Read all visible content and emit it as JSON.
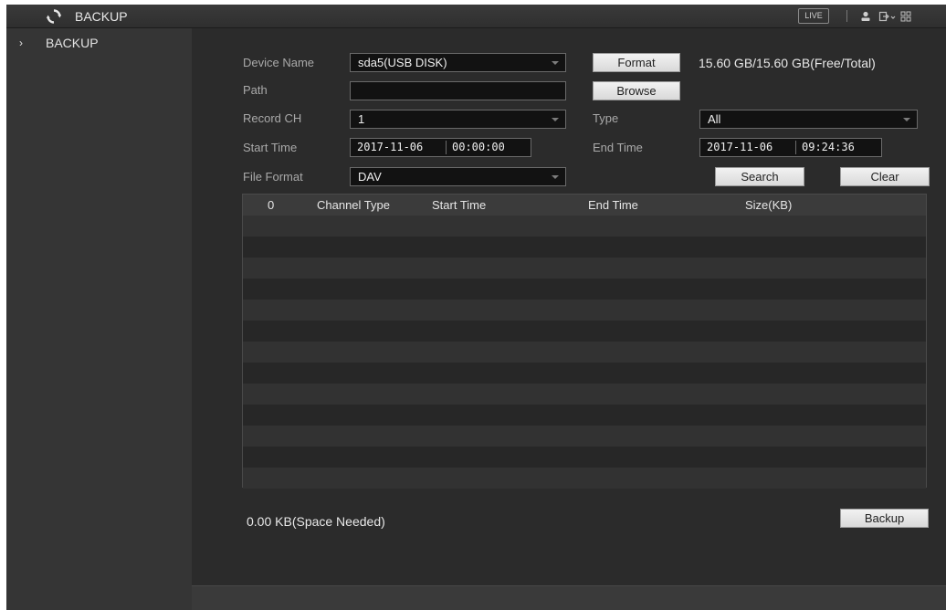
{
  "header": {
    "title": "BACKUP",
    "live_label": "LIVE",
    "icons": [
      "refresh-icon",
      "user-icon",
      "logout-icon",
      "grid-icon"
    ]
  },
  "sidebar": {
    "items": [
      {
        "label": "BACKUP",
        "icon": "chevron-right-icon"
      }
    ]
  },
  "form": {
    "device_name": {
      "label": "Device Name",
      "value": "sda5(USB DISK)"
    },
    "format_button": "Format",
    "capacity": "15.60 GB/15.60 GB(Free/Total)",
    "path": {
      "label": "Path",
      "value": ""
    },
    "browse_button": "Browse",
    "record_ch": {
      "label": "Record CH",
      "value": "1"
    },
    "type": {
      "label": "Type",
      "value": "All"
    },
    "start_time": {
      "label": "Start Time",
      "date": "2017-11-06",
      "time": "00:00:00"
    },
    "end_time": {
      "label": "End Time",
      "date": "2017-11-06",
      "time": "09:24:36"
    },
    "file_format": {
      "label": "File Format",
      "value": "DAV"
    },
    "search_button": "Search",
    "clear_button": "Clear"
  },
  "table": {
    "headers": {
      "index": "0",
      "channel_type": "Channel Type",
      "start_time": "Start Time",
      "end_time": "End Time",
      "size": "Size(KB)"
    },
    "rows": []
  },
  "footer": {
    "space_needed": "0.00 KB(Space Needed)",
    "backup_button": "Backup"
  },
  "colors": {
    "background": "#2b2b2b",
    "sidebar": "#353535",
    "field": "#121212",
    "button": "#e6e6e6"
  }
}
